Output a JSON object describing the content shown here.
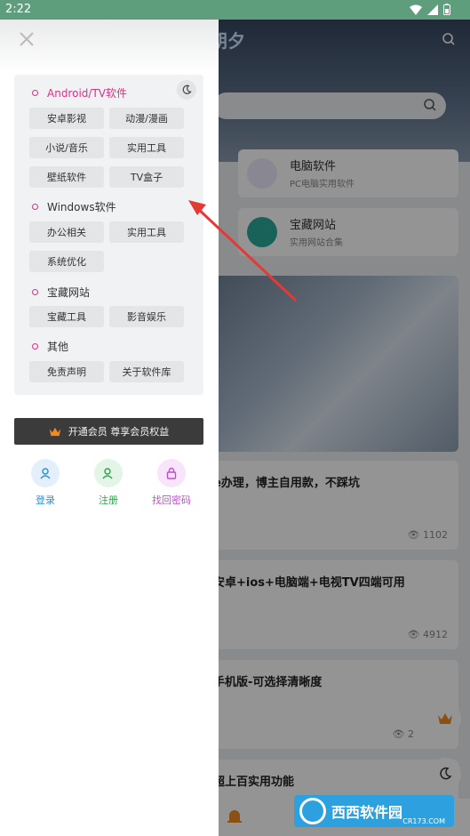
{
  "status_bar": {
    "time": "2:22"
  },
  "background_app": {
    "logo": "朝夕",
    "cards": [
      {
        "title": "电脑软件",
        "subtitle": "PC电脑实用软件"
      },
      {
        "title": "宝藏网站",
        "subtitle": "实用网站合集"
      }
    ],
    "articles": [
      {
        "title": "e办理，博主自用款，不踩坑",
        "views": "1102"
      },
      {
        "title": "安卓+ios+电脑端+电视TV四端可用",
        "views": "4912"
      },
      {
        "title": "手机版-可选择清晰度",
        "views": "2"
      },
      {
        "title": "超上百实用功能",
        "views": ""
      }
    ]
  },
  "drawer": {
    "sections": [
      {
        "title": "Android/TV软件",
        "items": [
          "安卓影视",
          "动漫/漫画",
          "小说/音乐",
          "实用工具",
          "壁纸软件",
          "TV盒子"
        ]
      },
      {
        "title": "Windows软件",
        "items": [
          "办公相关",
          "实用工具",
          "系统优化"
        ]
      },
      {
        "title": "宝藏网站",
        "items": [
          "宝藏工具",
          "影音娱乐"
        ]
      },
      {
        "title": "其他",
        "items": [
          "免责声明",
          "关于软件库"
        ]
      }
    ],
    "vip_label": "开通会员 尊享会员权益",
    "auth": {
      "login": "登录",
      "register": "注册",
      "recover": "找回密码"
    }
  },
  "watermark": {
    "brand": "西西软件园",
    "url": "CR173.COM"
  },
  "colors": {
    "accent": "#d63384",
    "status_bar": "#5f9e7c",
    "login": "#2b8ed8",
    "register": "#2fa24f",
    "recover": "#c24bd6",
    "arrow": "#e53935"
  }
}
